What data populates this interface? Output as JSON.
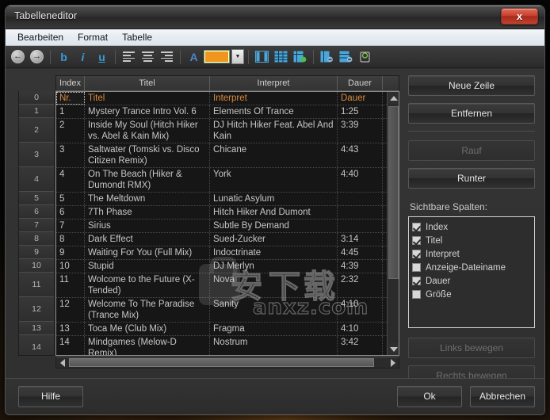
{
  "window": {
    "title": "Tabelleneditor",
    "close_label": "x"
  },
  "menubar": {
    "items": [
      {
        "label": "Bearbeiten"
      },
      {
        "label": "Format"
      },
      {
        "label": "Tabelle"
      }
    ]
  },
  "toolbar": {
    "back": "◄",
    "forward": "►",
    "bold": "b",
    "italic": "i",
    "underline": "u",
    "color_hex": "#f0961e",
    "dropdown_caret": "▼",
    "font_color_glyph": "A"
  },
  "table": {
    "columns": [
      "Index",
      "Titel",
      "Interpret",
      "Dauer",
      ""
    ],
    "gutter": [
      "0",
      "1",
      "2",
      "3",
      "4",
      "5",
      "6",
      "7",
      "8",
      "9",
      "10",
      "11",
      "12",
      "13",
      "14"
    ],
    "header_row": {
      "index": "Nr.",
      "titel": "Titel",
      "interpret": "Interpret",
      "dauer": "Dauer"
    },
    "rows": [
      {
        "index": "1",
        "titel": "Mystery Trance Intro Vol. 6",
        "interpret": "Elements Of Trance",
        "dauer": "1:25"
      },
      {
        "index": "2",
        "titel": "Inside My Soul (Hitch Hiker vs. Abel & Kain Mix)",
        "interpret": "DJ Hitch Hiker Feat. Abel And Kain",
        "dauer": "3:39"
      },
      {
        "index": "3",
        "titel": "Saltwater (Tomski vs. Disco Citizen Remix)",
        "interpret": "Chicane",
        "dauer": "4:43"
      },
      {
        "index": "4",
        "titel": "On The Beach (Hiker & Dumondt RMX)",
        "interpret": "York",
        "dauer": "4:40"
      },
      {
        "index": "5",
        "titel": "The Meltdown",
        "interpret": "Lunatic Asylum",
        "dauer": ""
      },
      {
        "index": "6",
        "titel": "7Th Phase",
        "interpret": "Hitch Hiker And Dumont",
        "dauer": ""
      },
      {
        "index": "7",
        "titel": "Sirius",
        "interpret": "Subtle By Demand",
        "dauer": ""
      },
      {
        "index": "8",
        "titel": "Dark Effect",
        "interpret": "Sued-Zucker",
        "dauer": "3:14"
      },
      {
        "index": "9",
        "titel": "Waiting For You (Full Mix)",
        "interpret": "Indoctrinate",
        "dauer": "4:45"
      },
      {
        "index": "10",
        "titel": "Stupid",
        "interpret": "DJ Merlyn",
        "dauer": "4:39"
      },
      {
        "index": "11",
        "titel": "Wolcome to the Future (X-Tended)",
        "interpret": "Nova",
        "dauer": "2:32"
      },
      {
        "index": "12",
        "titel": "Welcome To The Paradise (Trance Mix)",
        "interpret": "Sanity",
        "dauer": "4:10"
      },
      {
        "index": "13",
        "titel": "Toca Me (Club Mix)",
        "interpret": "Fragma",
        "dauer": "4:10"
      },
      {
        "index": "14",
        "titel": "Mindgames (Melow-D Remix)",
        "interpret": "Nostrum",
        "dauer": "3:42"
      }
    ]
  },
  "side": {
    "neue_zeile": "Neue Zeile",
    "entfernen": "Entfernen",
    "rauf": "Rauf",
    "runter": "Runter",
    "visible_columns_label": "Sichtbare Spalten:",
    "visible_columns": [
      {
        "label": "Index",
        "checked": true
      },
      {
        "label": "Titel",
        "checked": true
      },
      {
        "label": "Interpret",
        "checked": true
      },
      {
        "label": "Anzeige-Dateiname",
        "checked": false
      },
      {
        "label": "Dauer",
        "checked": true
      },
      {
        "label": "Größe",
        "checked": false
      }
    ],
    "links_bewegen": "Links bewegen",
    "rechts_bewegen": "Rechts bewegen"
  },
  "footer": {
    "hilfe": "Hilfe",
    "ok": "Ok",
    "abbrechen": "Abbrechen"
  },
  "watermark": {
    "text": "anxz.com",
    "cn1": "安",
    "cn2": "下",
    "cn3": "载"
  }
}
